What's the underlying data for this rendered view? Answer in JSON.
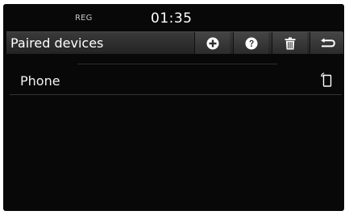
{
  "status_bar": {
    "reg_label": "REG",
    "time": "01:35"
  },
  "header": {
    "title": "Paired devices",
    "buttons": [
      {
        "icon": "plus-circle-icon"
      },
      {
        "icon": "help-icon"
      },
      {
        "icon": "trash-icon"
      },
      {
        "icon": "back-icon"
      }
    ]
  },
  "devices": [
    {
      "name": "Phone",
      "icon": "phone-connection-icon"
    }
  ],
  "colors": {
    "background": "#080808",
    "header": "#2e2e2e",
    "text": "#ffffff"
  }
}
